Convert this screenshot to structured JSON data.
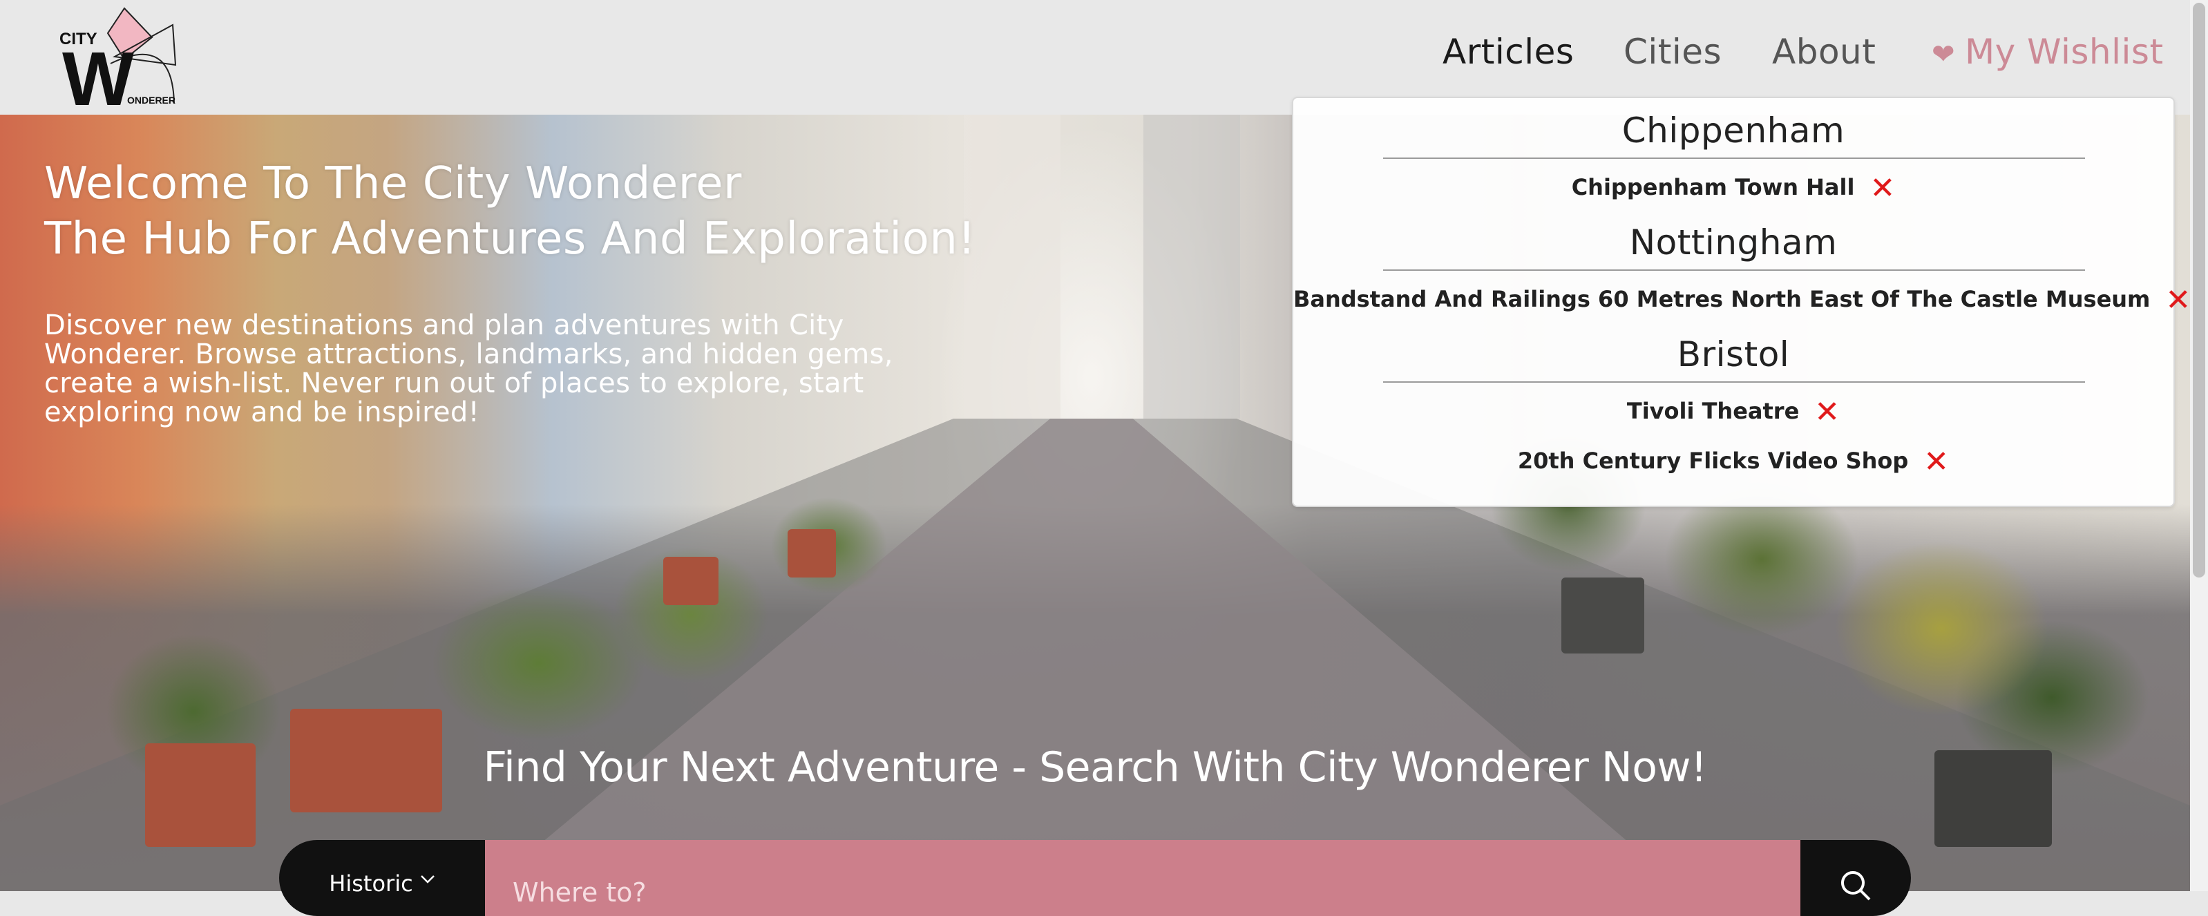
{
  "logo": {
    "top_text": "CITY",
    "big_letter": "W",
    "bottom_text": "ONDERER"
  },
  "nav": {
    "articles": "Articles",
    "cities": "Cities",
    "about": "About",
    "wishlist": "My Wishlist"
  },
  "hero": {
    "title_line1": "Welcome To The City Wonderer",
    "title_line2": "The Hub For Adventures And Exploration!",
    "description": "Discover new destinations and plan adventures with City Wonderer. Browse attractions, landmarks, and hidden gems, create a wish-list. Never run out of places to explore, start exploring now and be inspired!",
    "search_heading": "Find Your Next Adventure - Search With City Wonderer Now!"
  },
  "search": {
    "category": "Historic",
    "placeholder": "Where to?"
  },
  "wishlist": {
    "groups": [
      {
        "city": "Chippenham",
        "places": [
          "Chippenham Town Hall"
        ]
      },
      {
        "city": "Nottingham",
        "places": [
          "Bandstand And Railings 60 Metres North East Of The Castle Museum"
        ]
      },
      {
        "city": "Bristol",
        "places": [
          "Tivoli Theatre",
          "20th Century Flicks Video Shop"
        ]
      }
    ]
  },
  "colors": {
    "accent_pink": "#cc7f8b",
    "wishlist_pink": "#cc8a96",
    "remove_red": "#e0191a",
    "header_bg": "#e8e8e8"
  }
}
